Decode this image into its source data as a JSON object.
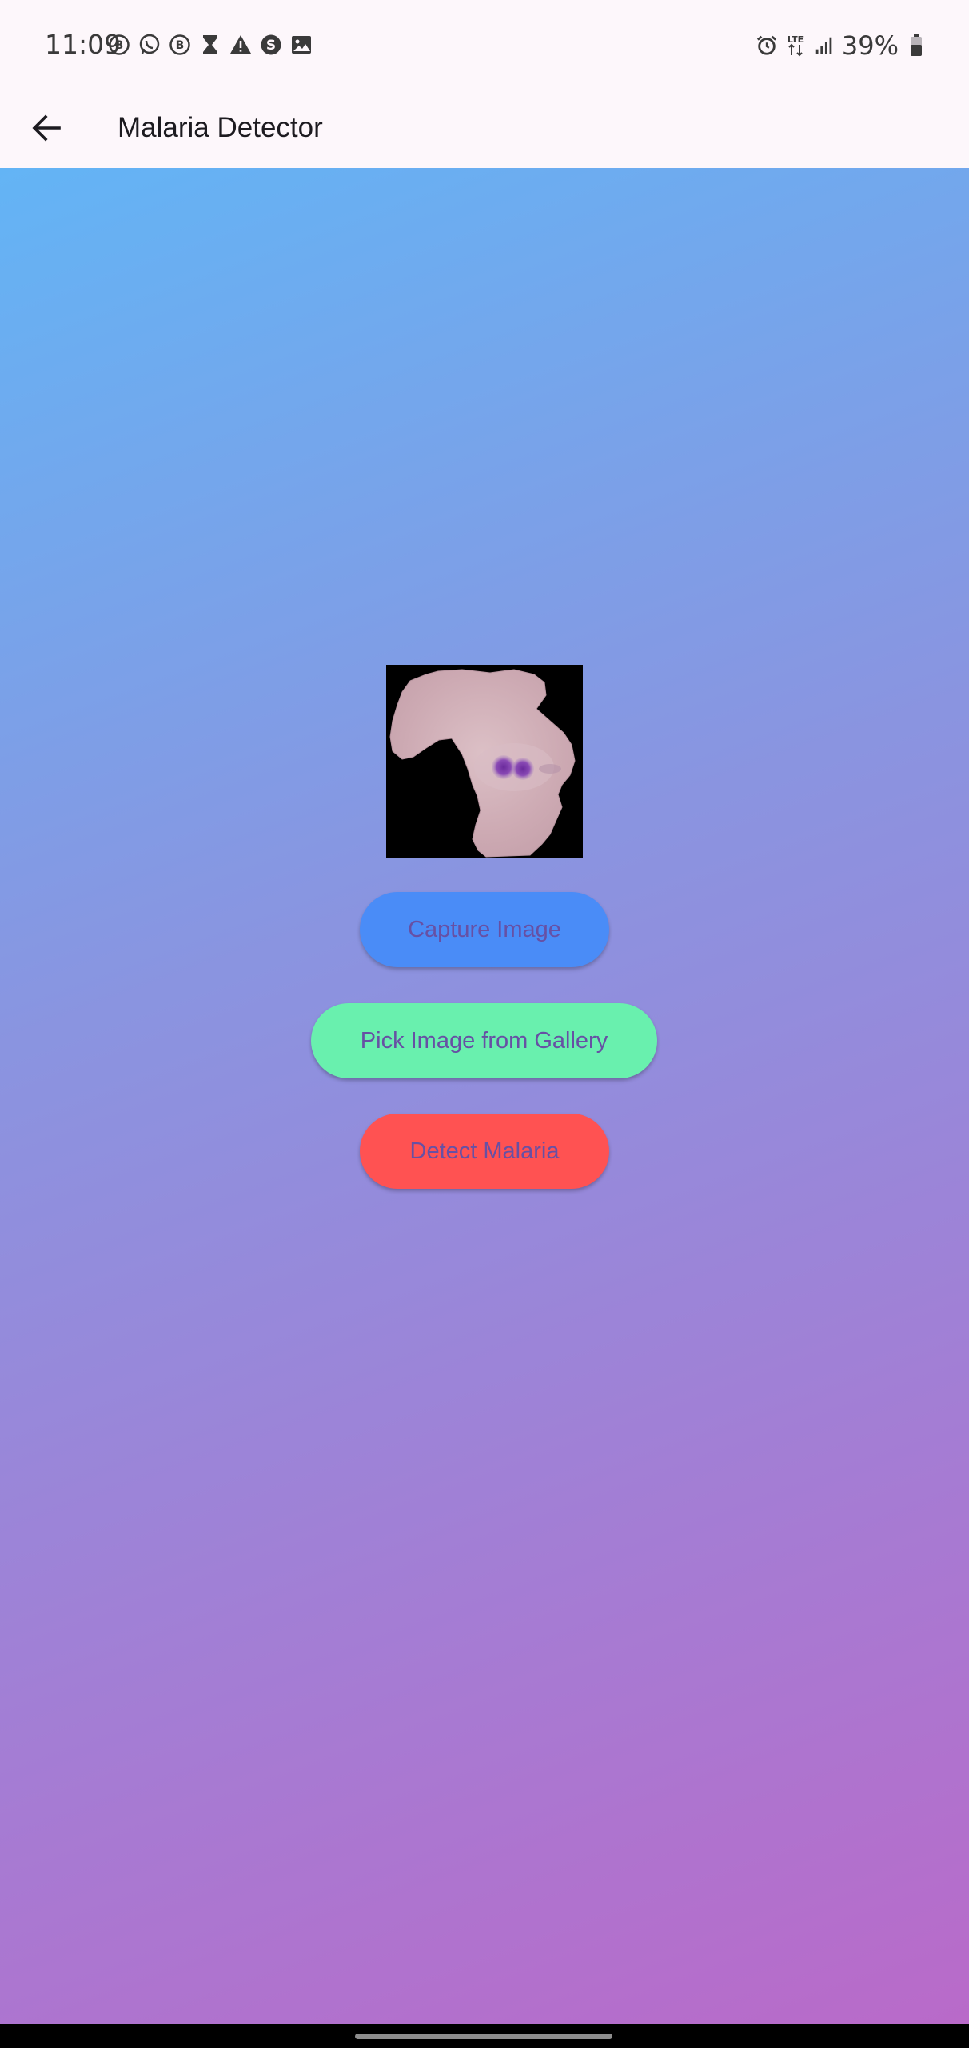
{
  "status_bar": {
    "time": "11:09",
    "battery": "39%",
    "network": "LTE"
  },
  "app_bar": {
    "title": "Malaria Detector"
  },
  "buttons": {
    "capture": "Capture Image",
    "gallery": "Pick Image from Gallery",
    "detect": "Detect Malaria"
  },
  "colors": {
    "capture_button": "#4a8cf7",
    "gallery_button": "#69f0ae",
    "detect_button": "#ff5252",
    "button_text": "#6750a4",
    "gradient_start": "#63b4f5",
    "gradient_end": "#b96ac9"
  },
  "icons": {
    "back": "arrow-left-icon"
  }
}
